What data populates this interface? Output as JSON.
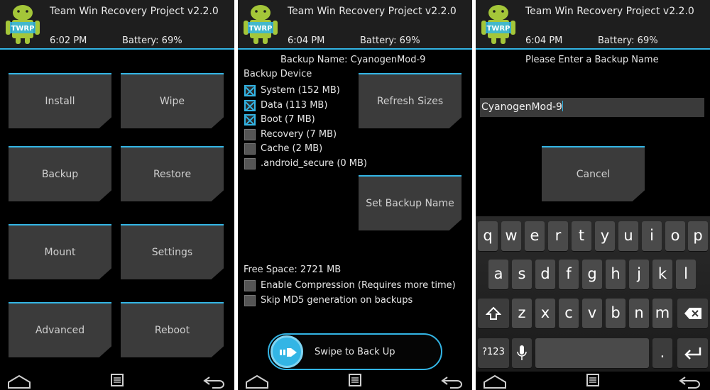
{
  "header": {
    "title": "Team Win Recovery Project  v2.2.0",
    "battery": "Battery: 69%"
  },
  "screen1": {
    "time": "6:02 PM",
    "buttons": [
      "Install",
      "Wipe",
      "Backup",
      "Restore",
      "Mount",
      "Settings",
      "Advanced",
      "Reboot"
    ]
  },
  "screen2": {
    "time": "6:04 PM",
    "backup_name": "Backup Name: CyanogenMod-9",
    "device_label": "Backup Device",
    "partitions": [
      {
        "label": "System (152 MB)",
        "checked": true
      },
      {
        "label": "Data (113 MB)",
        "checked": true
      },
      {
        "label": "Boot (7 MB)",
        "checked": true
      },
      {
        "label": "Recovery (7 MB)",
        "checked": false
      },
      {
        "label": "Cache (2 MB)",
        "checked": false
      },
      {
        "label": ".android_secure (0 MB)",
        "checked": false
      }
    ],
    "refresh_label": "Refresh Sizes",
    "set_name_label": "Set Backup Name",
    "free_space": "Free Space: 2721 MB",
    "options": [
      {
        "label": "Enable Compression (Requires more time)",
        "checked": false
      },
      {
        "label": "Skip MD5 generation on backups",
        "checked": false
      }
    ],
    "swipe_label": "Swipe to Back Up"
  },
  "screen3": {
    "time": "6:04 PM",
    "prompt": "Please Enter a Backup Name",
    "name_value": "CyanogenMod-9",
    "cancel_label": "Cancel",
    "keyboard": {
      "row1": [
        "q",
        "w",
        "e",
        "r",
        "t",
        "y",
        "u",
        "i",
        "o",
        "p"
      ],
      "row2": [
        "a",
        "s",
        "d",
        "f",
        "g",
        "h",
        "j",
        "k",
        "l"
      ],
      "row3": [
        "z",
        "x",
        "c",
        "v",
        "b",
        "n",
        "m"
      ],
      "symbols_label": "?123",
      "period": "."
    }
  },
  "colors": {
    "accent": "#33b5e5",
    "tile": "#3b3b3b",
    "background": "#000000"
  }
}
